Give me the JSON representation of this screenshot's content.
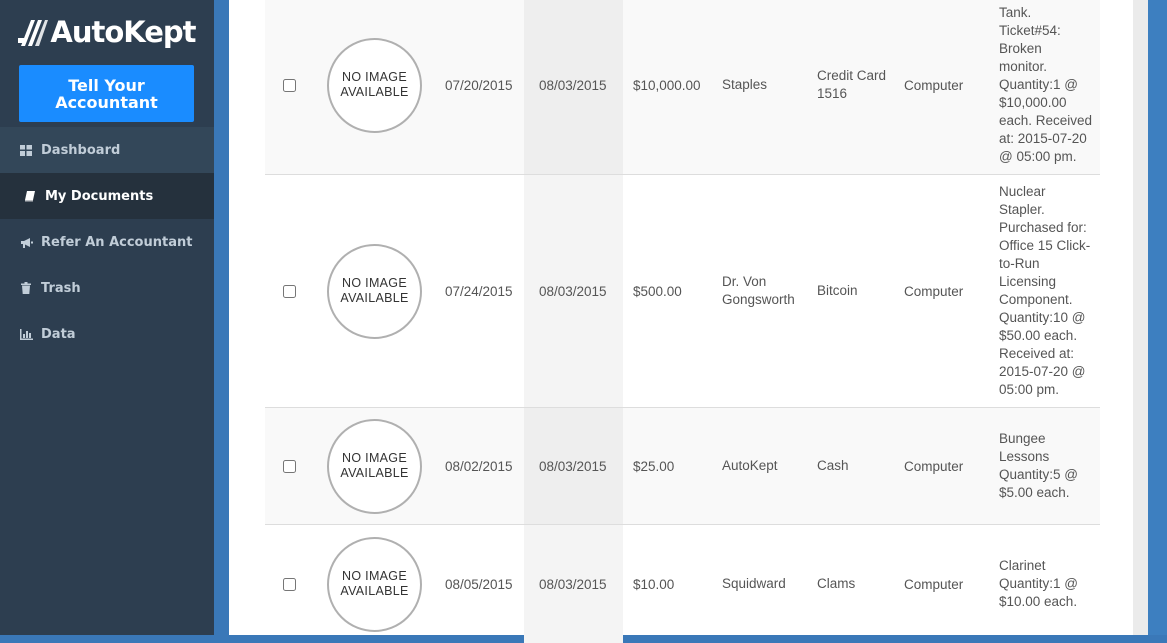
{
  "app": {
    "name": "AutoKept"
  },
  "sidebar": {
    "cta_label": "Tell Your Accountant",
    "items": [
      {
        "label": "Dashboard",
        "icon": "grid-icon"
      },
      {
        "label": "My Documents",
        "icon": "book-icon",
        "active": true
      },
      {
        "label": "Refer An Accountant",
        "icon": "megaphone-icon"
      },
      {
        "label": "Trash",
        "icon": "trash-icon"
      },
      {
        "label": "Data",
        "icon": "bar-chart-icon"
      }
    ]
  },
  "documents": {
    "no_image_text": "NO IMAGE AVAILABLE",
    "rows": [
      {
        "date": "07/20/2015",
        "uploaded": "08/03/2015",
        "amount": "$10,000.00",
        "vendor": "Staples",
        "payment": "Credit Card 1516",
        "source": "Computer",
        "description": "Tank. Ticket#54: Broken monitor. Quantity:1 @ $10,000.00 each. Received at: 2015-07-20 @ 05:00 pm."
      },
      {
        "date": "07/24/2015",
        "uploaded": "08/03/2015",
        "amount": "$500.00",
        "vendor": "Dr. Von Gongsworth",
        "payment": "Bitcoin",
        "source": "Computer",
        "description": "Nuclear Stapler. Purchased for: Office 15 Click-to-Run Licensing Component. Quantity:10 @ $50.00 each. Received at: 2015-07-20 @ 05:00 pm."
      },
      {
        "date": "08/02/2015",
        "uploaded": "08/03/2015",
        "amount": "$25.00",
        "vendor": "AutoKept",
        "payment": "Cash",
        "source": "Computer",
        "description": "Bungee Lessons Quantity:5 @ $5.00 each."
      },
      {
        "date": "08/05/2015",
        "uploaded": "08/03/2015",
        "amount": "$10.00",
        "vendor": "Squidward",
        "payment": "Clams",
        "source": "Computer",
        "description": "Clarinet Quantity:1 @ $10.00 each."
      }
    ]
  },
  "colors": {
    "sidebar": "#2d3e50",
    "accent": "#1a8cff",
    "frame": "#3a78b8"
  }
}
